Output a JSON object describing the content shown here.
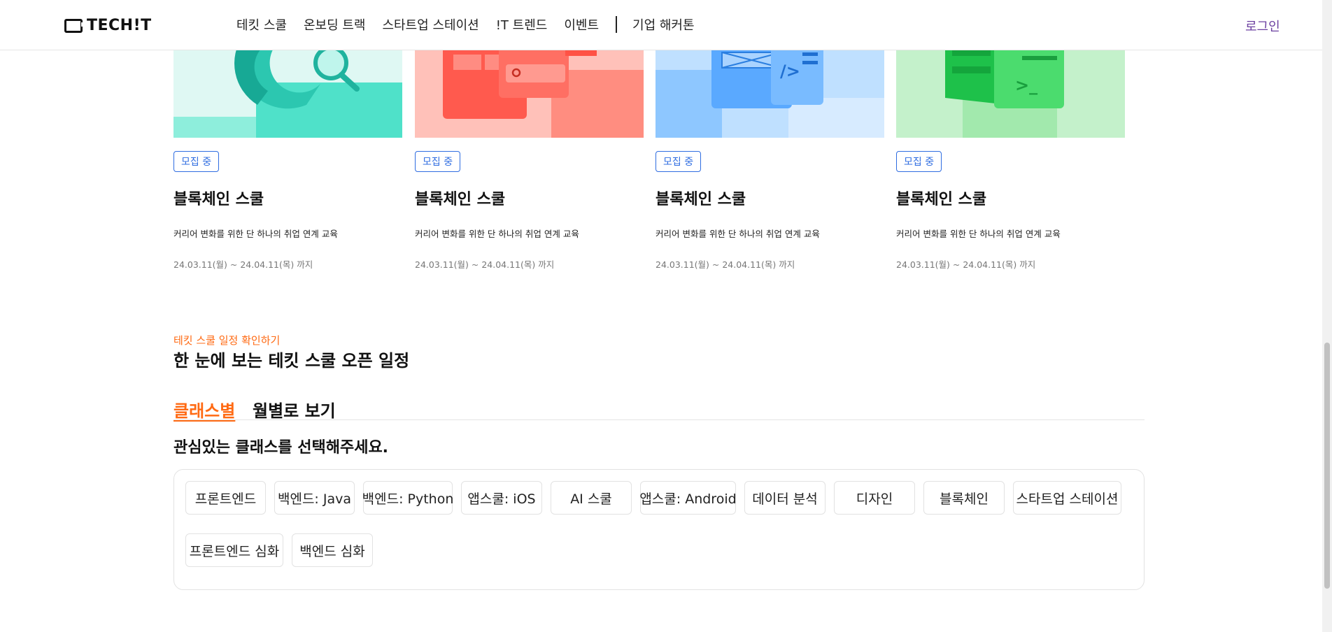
{
  "header": {
    "logo_text": "TECH!T",
    "nav": [
      "테킷 스쿨",
      "온보딩 트랙",
      "스타트업 스테이션",
      "!T 트렌드",
      "이벤트"
    ],
    "nav_after_sep": "기업 해커톤",
    "login": "로그인"
  },
  "cards": [
    {
      "badge": "모집 중",
      "title": "블록체인 스쿨",
      "desc": "커리어 변화를 위한 단 하나의 취업 연계 교육",
      "date": "24.03.11(월) ~ 24.04.11(목) 까지",
      "accent": "#3fd9c0"
    },
    {
      "badge": "모집 중",
      "title": "블록체인 스쿨",
      "desc": "커리어 변화를 위한 단 하나의 취업 연계 교육",
      "date": "24.03.11(월) ~ 24.04.11(목) 까지",
      "accent": "#ff7b6e"
    },
    {
      "badge": "모집 중",
      "title": "블록체인 스쿨",
      "desc": "커리어 변화를 위한 단 하나의 취업 연계 교육",
      "date": "24.03.11(월) ~ 24.04.11(목) 까지",
      "accent": "#5aa9ff"
    },
    {
      "badge": "모집 중",
      "title": "블록체인 스쿨",
      "desc": "커리어 변화를 위한 단 하나의 취업 연계 교육",
      "date": "24.03.11(월) ~ 24.04.11(목) 까지",
      "accent": "#39d862"
    }
  ],
  "schedule": {
    "eyebrow": "테킷 스쿨 일정 확인하기",
    "title": "한 눈에 보는 테킷 스쿨 오픈 일정",
    "tab_active": "클래스별",
    "tab_other": "월별로 보기",
    "prompt": "관심있는 클래스를 선택해주세요.",
    "chips": [
      "프론트엔드",
      "백엔드: Java",
      "백엔드: Python",
      "앱스쿨: iOS",
      "AI 스쿨",
      "앱스쿨: Android",
      "데이터 분석",
      "디자인",
      "블록체인",
      "스타트업 스테이션",
      "프론트엔드 심화",
      "백엔드 심화"
    ]
  },
  "colors": {
    "brand_orange": "#ff6a13",
    "badge_blue": "#2f6de1",
    "login_purple": "#6b3fa0"
  }
}
